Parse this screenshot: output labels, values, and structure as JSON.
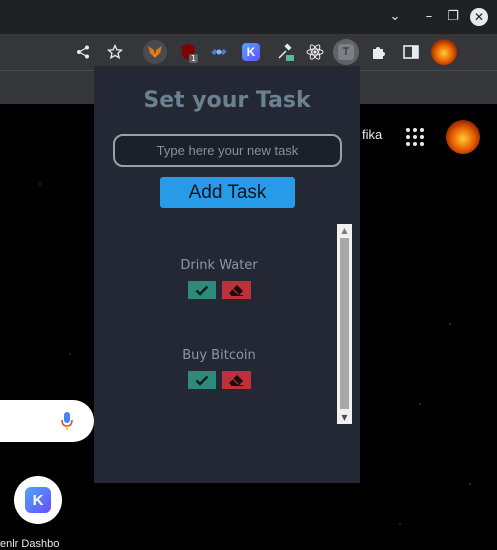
{
  "window": {
    "controls": {
      "minimize": "–",
      "maximize": "❐",
      "close": "✕",
      "tab_menu": "⌄"
    }
  },
  "toolbar": {
    "icons": [
      "share-icon",
      "star-icon",
      "metamask-icon",
      "ublock-icon",
      "satellite-icon",
      "k-extension-icon",
      "eyedropper-icon",
      "react-icon",
      "t-extension-icon",
      "puzzle-icon",
      "sidepanel-icon",
      "profile-avatar"
    ],
    "ublock_badge": "1",
    "t_extension_letter": "T",
    "k_letter": "K"
  },
  "page": {
    "partial_link": "fika",
    "shortcut": {
      "letter": "K",
      "label": "enlr Dashbo"
    }
  },
  "popup": {
    "title": "Set your Task",
    "input": {
      "placeholder": "Type here your new task",
      "value": ""
    },
    "add_button": "Add Task",
    "tasks": [
      {
        "label": "Drink Water"
      },
      {
        "label": "Buy Bitcoin"
      }
    ],
    "scroll": {
      "up": "▲",
      "down": "▼"
    }
  },
  "colors": {
    "popup_bg": "#232834",
    "title": "#6b8190",
    "add_button": "#289be8",
    "done_button": "#2f8a79",
    "delete_button": "#c0303a"
  }
}
